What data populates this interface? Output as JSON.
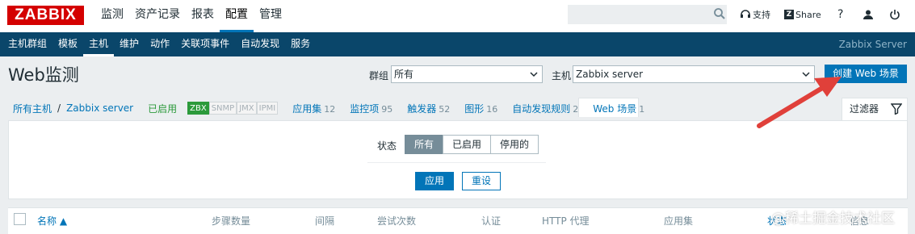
{
  "brand": {
    "logo": "ZABBIX"
  },
  "main_menu": [
    "监测",
    "资产记录",
    "报表",
    "配置",
    "管理"
  ],
  "top_links": {
    "support": "支持",
    "share_icon": "Z",
    "share": "Share",
    "help": "?"
  },
  "sub_menu": [
    "主机群组",
    "模板",
    "主机",
    "维护",
    "动作",
    "关联项事件",
    "自动发现",
    "服务"
  ],
  "server_name": "Zabbix Server",
  "page": {
    "title": "Web监测",
    "group_label": "群组",
    "group_value": "所有",
    "host_label": "主机",
    "host_value": "Zabbix server",
    "create_button": "创建 Web 场景"
  },
  "host_nav": {
    "all_hosts": "所有主机",
    "separator": "/",
    "host": "Zabbix server",
    "status": "已启用",
    "badges": [
      "ZBX",
      "SNMP",
      "JMX",
      "IPMI"
    ],
    "items": [
      {
        "label": "应用集",
        "count": "12"
      },
      {
        "label": "监控项",
        "count": "95"
      },
      {
        "label": "触发器",
        "count": "52"
      },
      {
        "label": "图形",
        "count": "16"
      },
      {
        "label": "自动发现规则",
        "count": "2"
      },
      {
        "label": "Web 场景",
        "count": "1"
      }
    ]
  },
  "filter": {
    "tab_label": "过滤器",
    "status_label": "状态",
    "options": [
      "所有",
      "已启用",
      "停用的"
    ],
    "selected": "所有",
    "apply": "应用",
    "reset": "重设"
  },
  "table_headers": [
    "名称 ▲",
    "步骤数量",
    "间隔",
    "尝试次数",
    "认证",
    "HTTP 代理",
    "应用集",
    "状态",
    "信息"
  ],
  "watermark": "@稀土掘金技术社区",
  "colors": {
    "brand_red": "#d40000",
    "accent_blue": "#0275b8",
    "subnav_bg": "#0a466a",
    "enabled_green": "#2c9a3b",
    "arrow_red": "#e0403a"
  }
}
